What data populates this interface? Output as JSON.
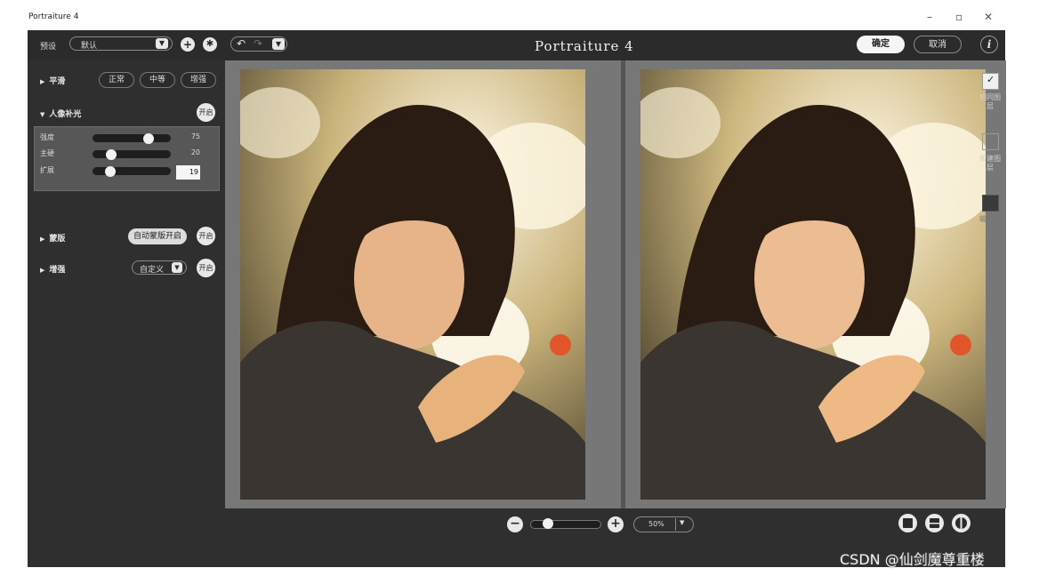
{
  "window": {
    "title": "Portraiture 4",
    "minimize_icon": "minimize-icon",
    "restore_icon": "restore-icon",
    "close_icon": "close-icon"
  },
  "topbar": {
    "preset_label": "预设",
    "preset_value": "默认",
    "logo": "Portraiture 4",
    "ok_label": "确定",
    "cancel_label": "取消",
    "info_label": "i"
  },
  "panel": {
    "smooth": {
      "label": "平滑",
      "options": [
        "正常",
        "中等",
        "增强"
      ]
    },
    "portrait_light": {
      "label": "人像补光",
      "toggle": "开启",
      "sliders": [
        {
          "label": "强度",
          "value": "75",
          "fraction": 0.75
        },
        {
          "label": "主硬",
          "value": "20",
          "fraction": 0.2
        },
        {
          "label": "扩展",
          "value": "19",
          "fraction": 0.19
        }
      ]
    },
    "mask": {
      "label": "蒙版",
      "auto_label": "自动蒙版开启",
      "toggle": "开启"
    },
    "enhance": {
      "label": "增强",
      "select_value": "自定义",
      "toggle": "开启"
    }
  },
  "right_toolbar": {
    "same_layer": "相同图层",
    "new_layer": "新建图层",
    "output_mask": "输出蒙板"
  },
  "bottom": {
    "zoom_value": "50%",
    "zoom_fraction": 0.2
  },
  "watermark": "CSDN @仙剑魔尊重楼",
  "colors": {
    "app_bg": "#2f2f2f",
    "topbar_bg": "#2b2b2b",
    "preview_bg": "#777777",
    "accent": "#f5f5f5"
  }
}
